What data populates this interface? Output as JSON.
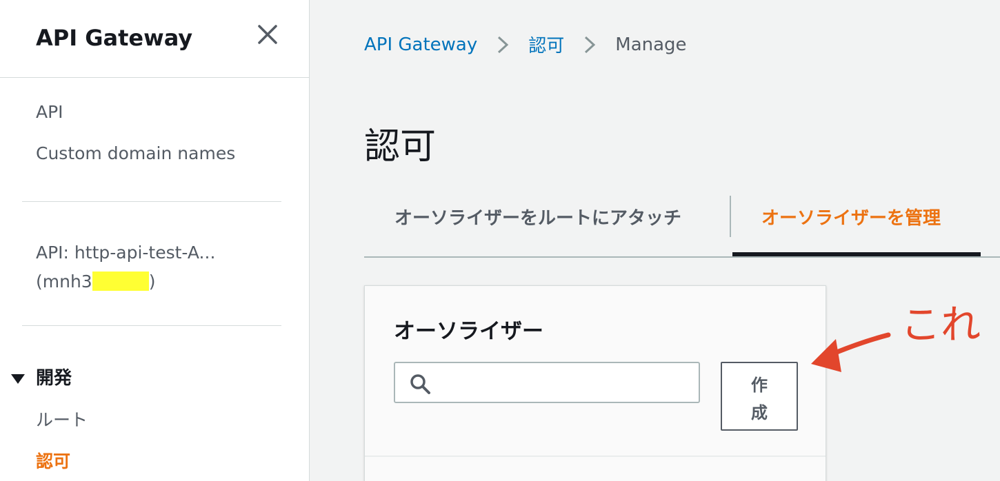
{
  "sidebar": {
    "title": "API Gateway",
    "nav": [
      {
        "label": "API"
      },
      {
        "label": "Custom domain names"
      }
    ],
    "api_line1": "API: http-api-test-A...",
    "api_line2_prefix": "(mnh3",
    "api_line2_suffix": ")",
    "section_label": "開発",
    "section_items": [
      {
        "label": "ルート"
      },
      {
        "label": "認可"
      }
    ]
  },
  "breadcrumb": {
    "items": [
      "API Gateway",
      "認可"
    ],
    "current": "Manage"
  },
  "page_title": "認可",
  "tabs": [
    {
      "label": "オーソライザーをルートにアタッチ",
      "active": false
    },
    {
      "label": "オーソライザーを管理",
      "active": true
    }
  ],
  "panel": {
    "title": "オーソライザー",
    "search_value": "",
    "create_label_line1": "作",
    "create_label_line2": "成"
  },
  "annotation": {
    "text": "これ"
  },
  "colors": {
    "accent": "#ec7211",
    "link": "#0073bb",
    "annotation": "#e2462c",
    "redaction": "#ffff33"
  }
}
